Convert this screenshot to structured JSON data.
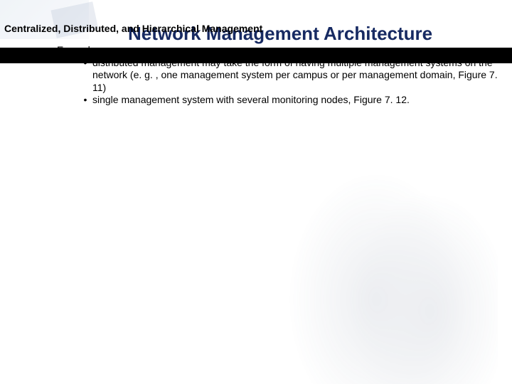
{
  "subtitle": "Centralized, Distributed, and Hierarchical Management",
  "title": "Network Management Architecture",
  "bullets": {
    "lvl1": {
      "marker": "•",
      "text": "Example"
    },
    "lvl2a": {
      "marker": "•",
      "text": "distributed management may take the form of having multiple management systems on the network (e. g. , one management system per campus or per management domain, Figure 7. 11)"
    },
    "lvl2b": {
      "marker": "•",
      "text": "single management system with several monitoring nodes, Figure 7. 12."
    }
  }
}
